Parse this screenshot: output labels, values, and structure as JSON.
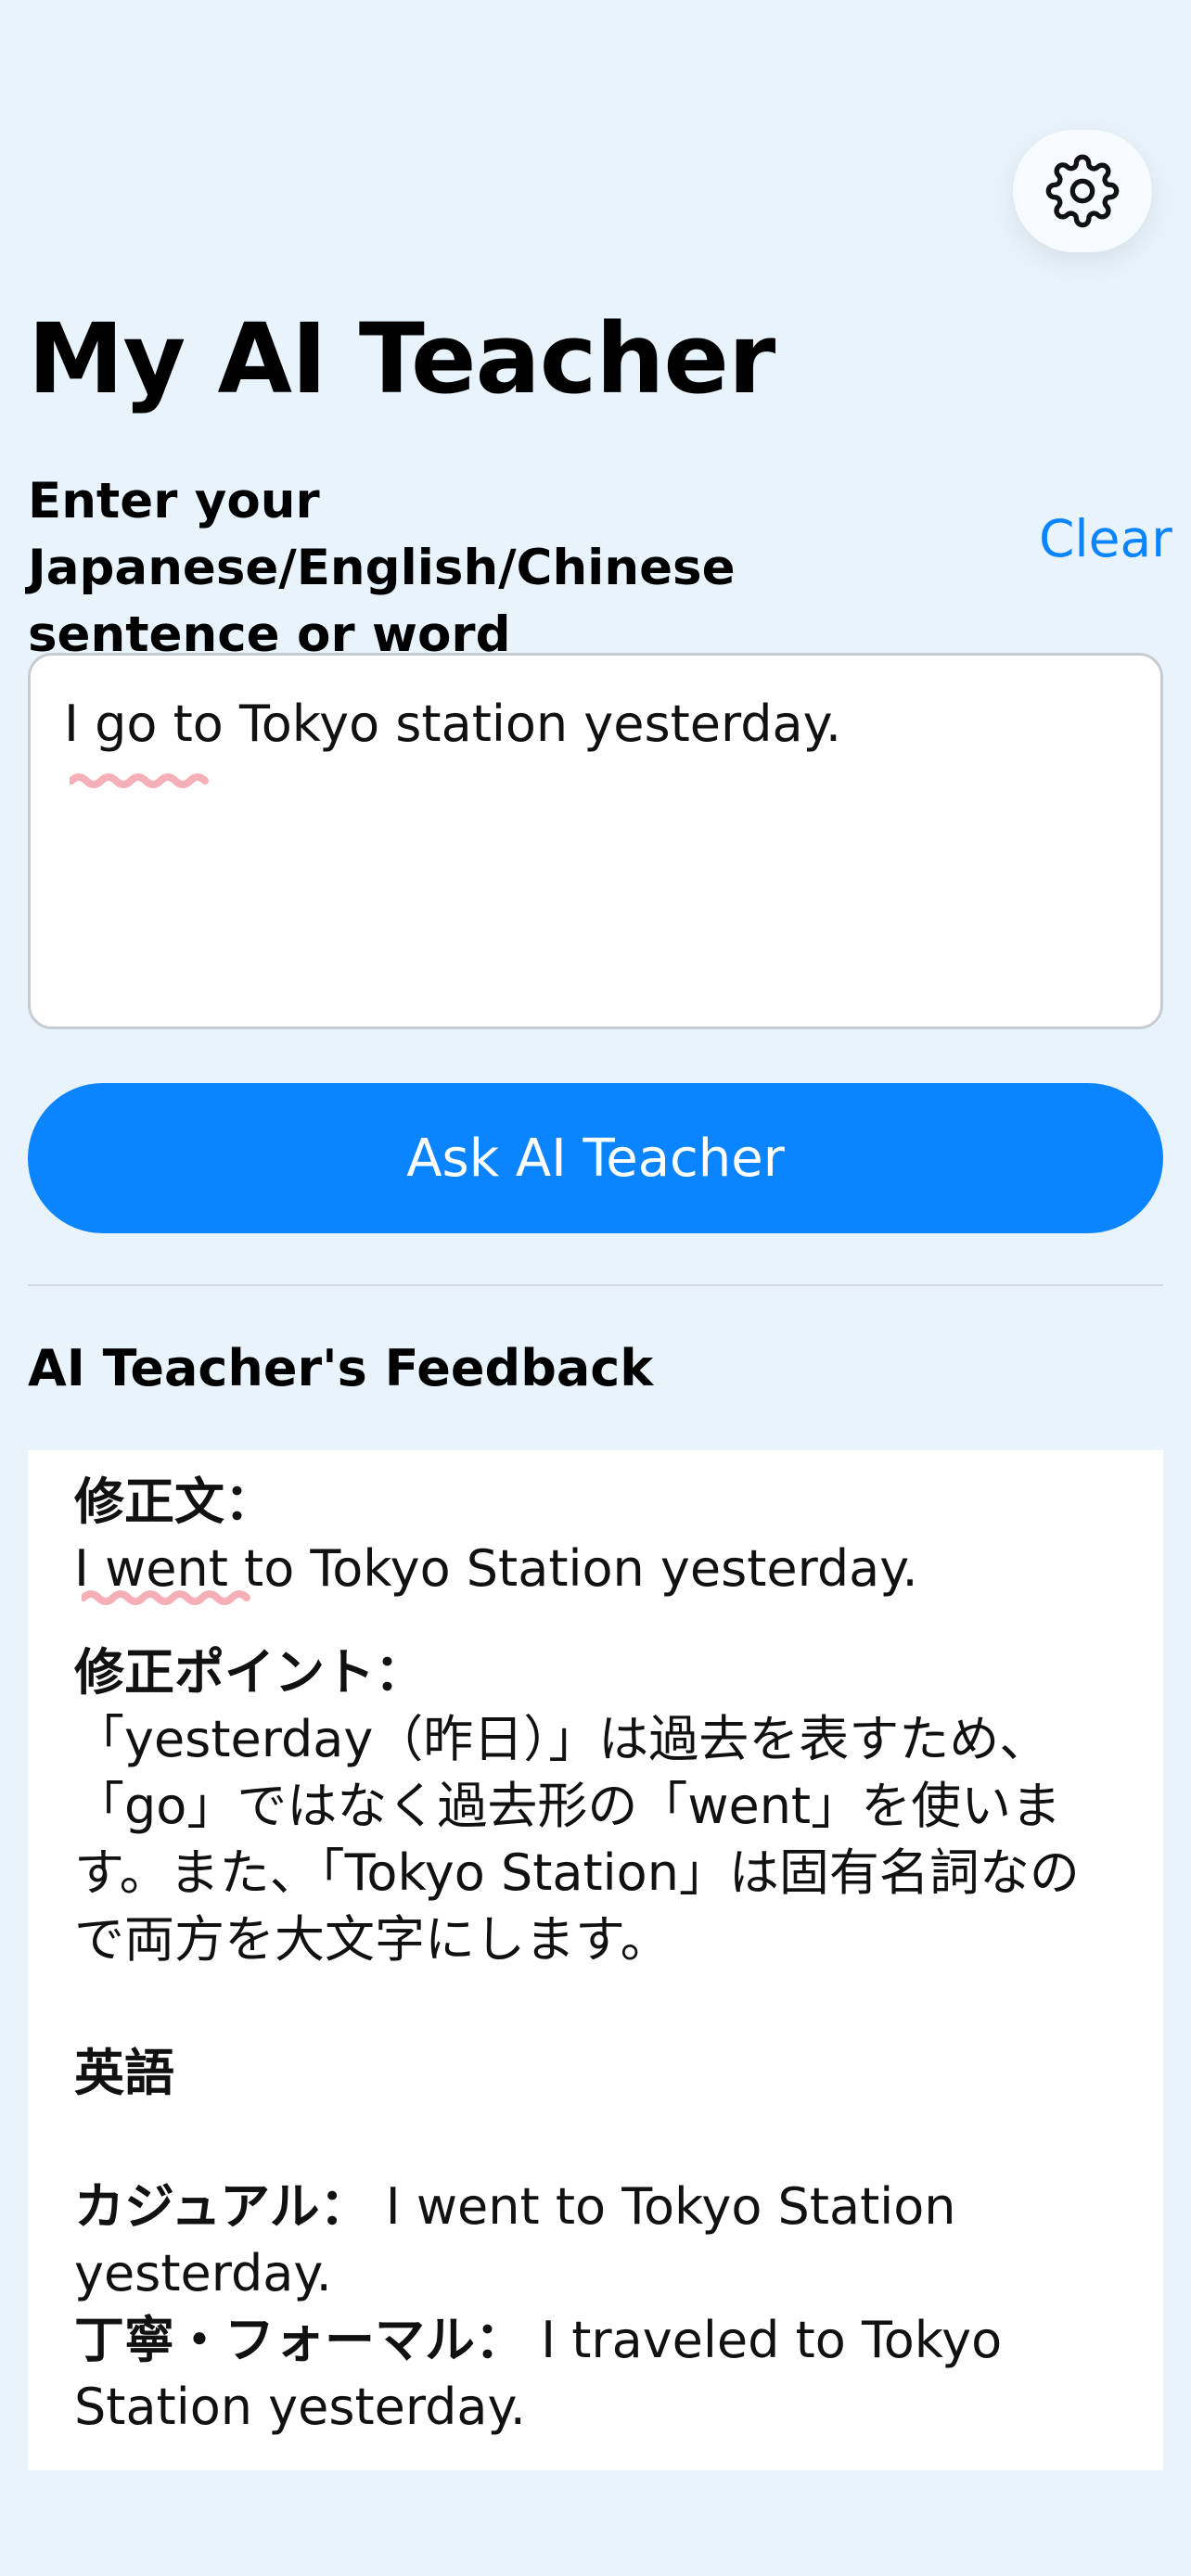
{
  "header": {
    "settings_icon": "gear-icon",
    "title": "My AI Teacher"
  },
  "input": {
    "label": "Enter your Japanese/English/Chinese sentence or word",
    "clear_label": "Clear",
    "value": "I go to Tokyo station yesterday."
  },
  "ask_button": {
    "label": "Ask AI Teacher"
  },
  "feedback": {
    "title": "AI Teacher's Feedback",
    "corrected_label": "修正文：",
    "corrected_text": "I went to Tokyo Station yesterday.",
    "points_label": "修正ポイント：",
    "points_text": "「yesterday（昨日）」は過去を表すため、「go」ではなく過去形の「went」を使います。また、「Tokyo Station」は固有名詞なので両方を大文字にします。",
    "english_label": "英語",
    "casual_label": "カジュアル：",
    "casual_text": "I went to Tokyo Station yesterday.",
    "formal_label": "丁寧・フォーマル：",
    "formal_text": "I traveled to Tokyo Station yesterday."
  },
  "colors": {
    "background": "#E8F3FC",
    "accent": "#0A84FF",
    "card": "#FFFFFF"
  }
}
